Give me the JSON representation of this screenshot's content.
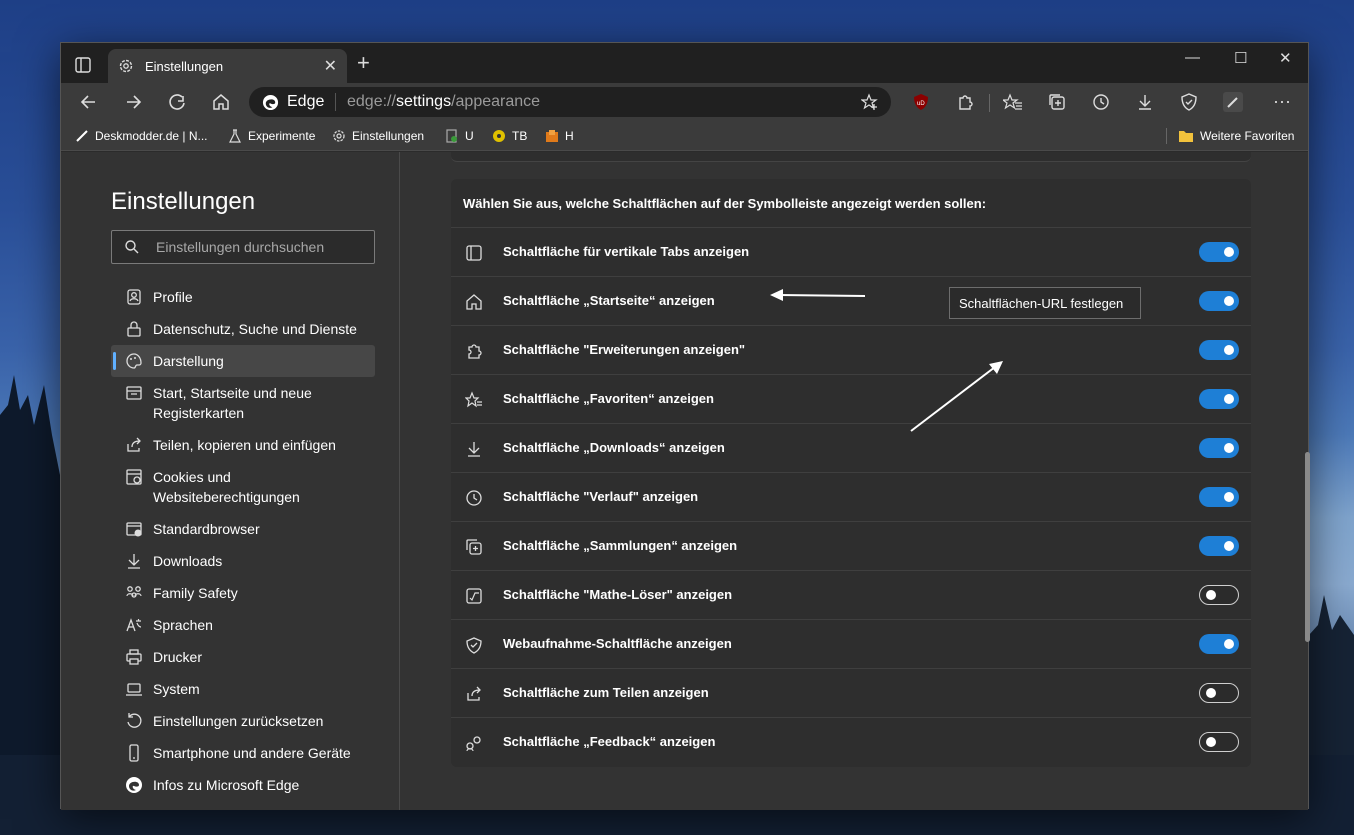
{
  "browser": {
    "tab_title": "Einstellungen",
    "address_brand": "Edge",
    "url_scheme": "edge://",
    "url_host": "settings",
    "url_path": "/appearance"
  },
  "favorites_bar": {
    "items": [
      {
        "label": "Deskmodder.de | N...",
        "icon": "deskmodder-icon"
      },
      {
        "label": "Experimente",
        "icon": "flask-icon"
      },
      {
        "label": "Einstellungen",
        "icon": "gear-icon"
      },
      {
        "label": "U",
        "icon": "recycle-icon"
      },
      {
        "label": "TB",
        "icon": "circle-icon"
      },
      {
        "label": "H",
        "icon": "orange-folder-icon"
      }
    ],
    "other_favorites": "Weitere Favoriten"
  },
  "sidebar": {
    "title": "Einstellungen",
    "search_placeholder": "Einstellungen durchsuchen",
    "items": [
      {
        "label": "Profile",
        "icon": "profile-icon"
      },
      {
        "label": "Datenschutz, Suche und Dienste",
        "icon": "lock-icon"
      },
      {
        "label": "Darstellung",
        "icon": "palette-icon",
        "active": true
      },
      {
        "label": "Start, Startseite und neue Registerkarten",
        "icon": "start-icon"
      },
      {
        "label": "Teilen, kopieren und einfügen",
        "icon": "share-icon"
      },
      {
        "label": "Cookies und Websiteberechtigungen",
        "icon": "cookie-icon"
      },
      {
        "label": "Standardbrowser",
        "icon": "default-browser-icon"
      },
      {
        "label": "Downloads",
        "icon": "download-icon"
      },
      {
        "label": "Family Safety",
        "icon": "family-icon"
      },
      {
        "label": "Sprachen",
        "icon": "language-icon"
      },
      {
        "label": "Drucker",
        "icon": "printer-icon"
      },
      {
        "label": "System",
        "icon": "laptop-icon"
      },
      {
        "label": "Einstellungen zurücksetzen",
        "icon": "reset-icon"
      },
      {
        "label": "Smartphone und andere Geräte",
        "icon": "phone-icon"
      },
      {
        "label": "Infos zu Microsoft Edge",
        "icon": "edge-icon"
      }
    ]
  },
  "toolbar_section": {
    "heading": "Wählen Sie aus, welche Schaltflächen auf der Symbolleiste angezeigt werden sollen:",
    "tooltip": "Schaltflächen-URL festlegen",
    "rows": [
      {
        "label": "Schaltfläche für vertikale Tabs anzeigen",
        "icon": "vertical-tabs-icon",
        "on": true
      },
      {
        "label": "Schaltfläche „Startseite“ anzeigen",
        "icon": "home-icon",
        "on": true
      },
      {
        "label": "Schaltfläche \"Erweiterungen anzeigen\"",
        "icon": "puzzle-icon",
        "on": true
      },
      {
        "label": "Schaltfläche „Favoriten“ anzeigen",
        "icon": "favorites-icon",
        "on": true
      },
      {
        "label": "Schaltfläche „Downloads“ anzeigen",
        "icon": "download-icon",
        "on": true
      },
      {
        "label": "Schaltfläche \"Verlauf\" anzeigen",
        "icon": "history-icon",
        "on": true
      },
      {
        "label": "Schaltfläche „Sammlungen“ anzeigen",
        "icon": "collections-icon",
        "on": true
      },
      {
        "label": "Schaltfläche \"Mathe-Löser\" anzeigen",
        "icon": "math-icon",
        "on": false
      },
      {
        "label": "Webaufnahme-Schaltfläche anzeigen",
        "icon": "web-capture-icon",
        "on": true
      },
      {
        "label": "Schaltfläche zum Teilen anzeigen",
        "icon": "share-icon",
        "on": false
      },
      {
        "label": "Schaltfläche „Feedback“ anzeigen",
        "icon": "feedback-icon",
        "on": false
      }
    ]
  },
  "colors": {
    "accent": "#1e7fd6",
    "active_indicator": "#60b0ff",
    "background": "#333333"
  }
}
